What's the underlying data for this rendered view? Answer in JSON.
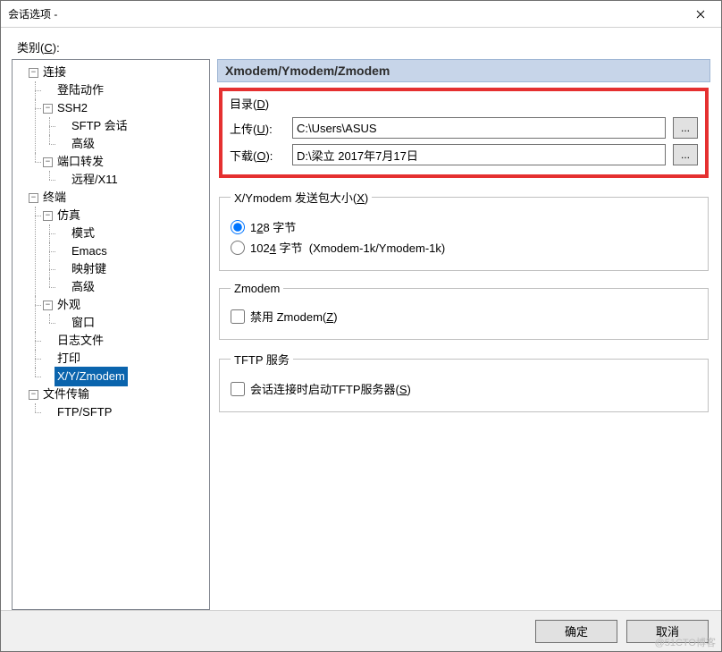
{
  "window": {
    "title": "会话选项 -"
  },
  "category_label": "类别(C):",
  "tree": {
    "n_connection": "连接",
    "n_login": "登陆动作",
    "n_ssh2": "SSH2",
    "n_sftp": "SFTP 会话",
    "n_adv1": "高级",
    "n_portfwd": "端口转发",
    "n_x11": "远程/X11",
    "n_terminal": "终端",
    "n_emulation": "仿真",
    "n_mode": "模式",
    "n_emacs": "Emacs",
    "n_mapkey": "映射键",
    "n_adv2": "高级",
    "n_appearance": "外观",
    "n_window": "窗口",
    "n_logfile": "日志文件",
    "n_print": "打印",
    "n_xyz": "X/Y/Zmodem",
    "n_filetrans": "文件传输",
    "n_ftpsftp": "FTP/SFTP"
  },
  "panel": {
    "header": "Xmodem/Ymodem/Zmodem",
    "dir_group": "目录(D)",
    "upload_label": "上传(U):",
    "upload_value": "C:\\Users\\ASUS",
    "download_label": "下载(O):",
    "download_value": "D:\\梁立 2017年7月17日",
    "browse": "...",
    "pkt_group": "X/Ymodem 发送包大小(X)",
    "pkt_128": "128 字节",
    "pkt_1024_a": "1024 字节",
    "pkt_1024_b": "(Xmodem-1k/Ymodem-1k)",
    "zmodem_group": "Zmodem",
    "zmodem_disable": "禁用 Zmodem(Z)",
    "tftp_group": "TFTP 服务",
    "tftp_check": "会话连接时启动TFTP服务器(S)"
  },
  "buttons": {
    "ok": "确定",
    "cancel": "取消"
  },
  "watermark": "@51CTO博客"
}
